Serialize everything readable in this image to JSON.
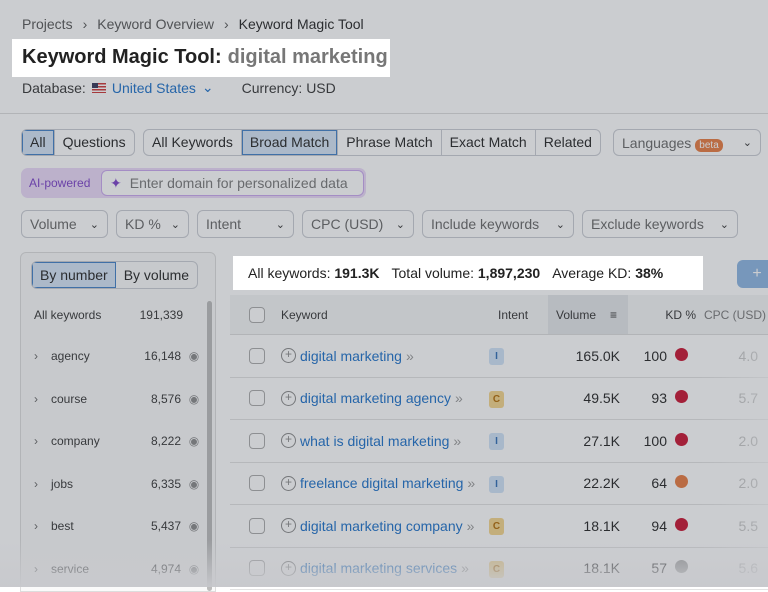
{
  "breadcrumb": [
    "Projects",
    "Keyword Overview",
    "Keyword Magic Tool"
  ],
  "title": {
    "tool": "Keyword Magic Tool:",
    "query": "digital marketing"
  },
  "database": {
    "label": "Database:",
    "value": "United States",
    "currency": "Currency: USD"
  },
  "tabs1": [
    "All",
    "Questions"
  ],
  "tabs2": [
    "All Keywords",
    "Broad Match",
    "Phrase Match",
    "Exact Match",
    "Related"
  ],
  "languages": {
    "label": "Languages",
    "badge": "beta"
  },
  "ai": {
    "label": "AI-powered",
    "placeholder": "Enter domain for personalized data"
  },
  "filters": [
    "Volume",
    "KD %",
    "Intent",
    "CPC (USD)",
    "Include keywords",
    "Exclude keywords"
  ],
  "sidebar": {
    "toggle": [
      "By number",
      "By volume"
    ],
    "all_label": "All keywords",
    "all_count": "191,339",
    "items": [
      {
        "name": "agency",
        "count": "16,148"
      },
      {
        "name": "course",
        "count": "8,576"
      },
      {
        "name": "company",
        "count": "8,222"
      },
      {
        "name": "jobs",
        "count": "6,335"
      },
      {
        "name": "best",
        "count": "5,437"
      },
      {
        "name": "service",
        "count": "4,974"
      }
    ]
  },
  "stats": {
    "all_label": "All keywords:",
    "all_value": "191.3K",
    "vol_label": "Total volume:",
    "vol_value": "1,897,230",
    "kd_label": "Average KD:",
    "kd_value": "38%"
  },
  "table": {
    "headers": [
      "Keyword",
      "Intent",
      "Volume",
      "KD %",
      "CPC (USD)"
    ],
    "rows": [
      {
        "keyword": "digital marketing",
        "intent": "I",
        "volume": "165.0K",
        "kd": "100",
        "kd_color": "#c8102e",
        "cpc": "4.0"
      },
      {
        "keyword": "digital marketing agency",
        "intent": "C",
        "volume": "49.5K",
        "kd": "93",
        "kd_color": "#c8102e",
        "cpc": "5.7"
      },
      {
        "keyword": "what is digital marketing",
        "intent": "I",
        "volume": "27.1K",
        "kd": "100",
        "kd_color": "#c8102e",
        "cpc": "2.0"
      },
      {
        "keyword": "freelance digital marketing",
        "intent": "I",
        "volume": "22.2K",
        "kd": "64",
        "kd_color": "#e8793d",
        "cpc": "2.0"
      },
      {
        "keyword": "digital marketing company",
        "intent": "C",
        "volume": "18.1K",
        "kd": "94",
        "kd_color": "#c8102e",
        "cpc": "5.5"
      },
      {
        "keyword": "digital marketing services",
        "intent": "C",
        "volume": "18.1K",
        "kd": "57",
        "kd_color": "#999999",
        "cpc": "5.6"
      }
    ]
  }
}
